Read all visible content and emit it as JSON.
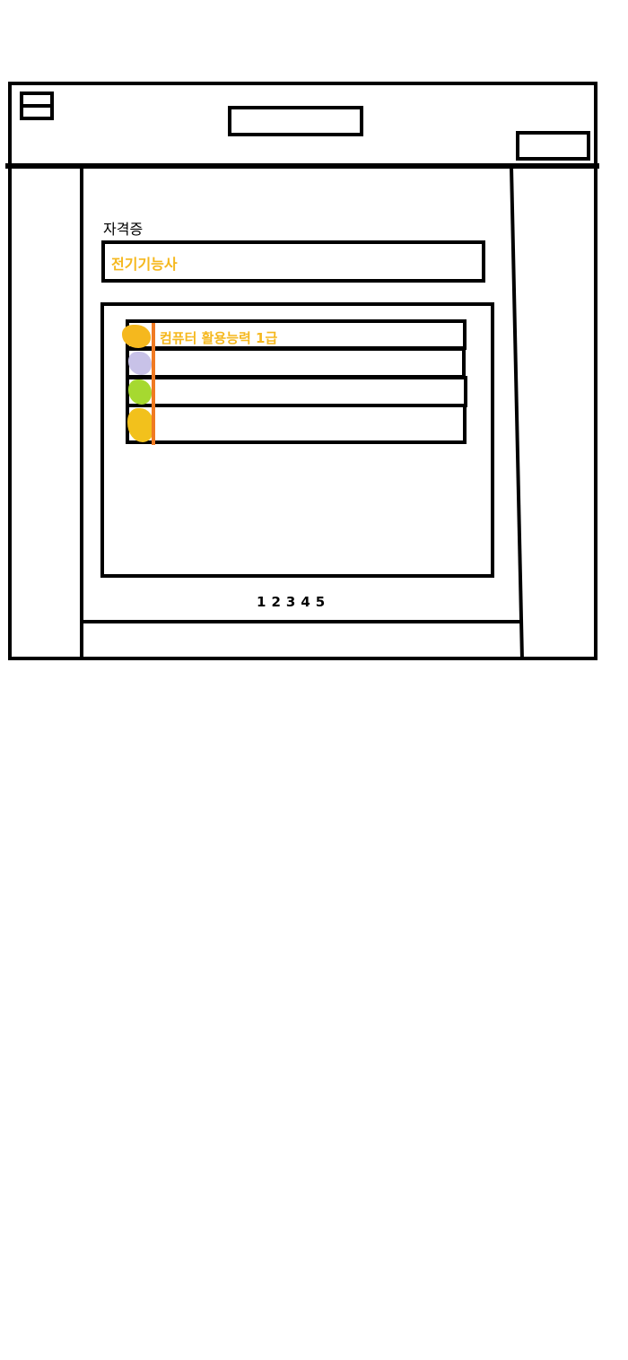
{
  "section": {
    "label": "자격증",
    "input_value": "전기기능사"
  },
  "certificate_list": {
    "items": [
      {
        "label": "컴퓨터 활용능력 1급",
        "icon": "orange-blob-icon",
        "color": "#f5b81e"
      },
      {
        "label": "",
        "icon": "lavender-blob-icon",
        "color": "#c8c2e8"
      },
      {
        "label": "",
        "icon": "green-blob-icon",
        "color": "#a6d930"
      },
      {
        "label": "",
        "icon": "yellow-blob-icon",
        "color": "#f2c11c"
      }
    ]
  },
  "pagination": {
    "pages": [
      "1",
      "2",
      "3",
      "4",
      "5"
    ]
  },
  "colors": {
    "highlight_text": "#f5b81e",
    "divider_accent": "#f07a22"
  }
}
